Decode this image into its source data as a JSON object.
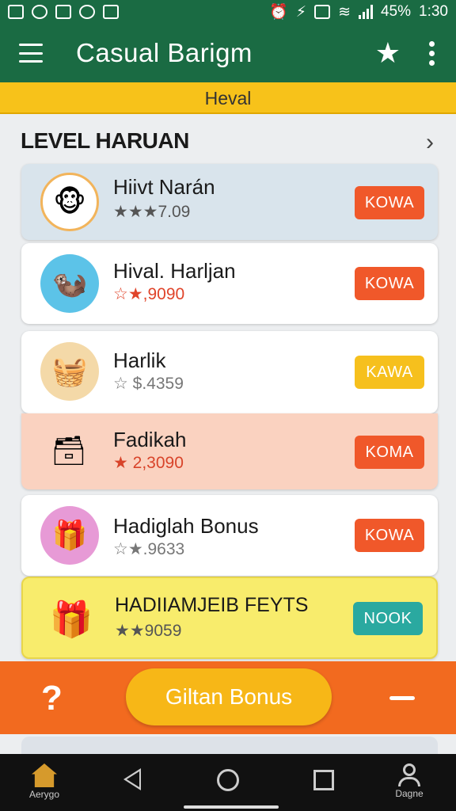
{
  "status_bar": {
    "battery": "45%",
    "time": "1:30"
  },
  "app_bar": {
    "title": "Casual  Barigm"
  },
  "banner": {
    "text": "Heval"
  },
  "section": {
    "title": "LEVEL HARUAN"
  },
  "items": [
    {
      "name": "Hiivt Narán",
      "rating": "★★★7.09",
      "button": "KOWA",
      "button_color": "#f0582a",
      "card_bg": "#d9e4ec",
      "avatar_bg": "#ffffff"
    },
    {
      "name": "Hival. Harljan",
      "rating": "☆★,9090",
      "button": "KOWA",
      "button_color": "#f0582a",
      "card_bg": "#ffffff",
      "avatar_bg": "#5cc3e8"
    },
    {
      "name": "Harlik",
      "rating": "☆ $.4359",
      "button": "KAWA",
      "button_color": "#f6c01d",
      "card_bg": "#ffffff",
      "avatar_bg": "#f4d9a8"
    },
    {
      "name": "Fadikah",
      "rating": "★ 2,3090",
      "button": "KOMA",
      "button_color": "#f0582a",
      "card_bg": "#fad2c0",
      "avatar_bg": "transparent"
    },
    {
      "name": "Hadiglah Bonus",
      "rating": "☆★.9633",
      "button": "KOWA",
      "button_color": "#f0582a",
      "card_bg": "#ffffff",
      "avatar_bg": "#e79ad6"
    },
    {
      "name": "HADIIAMJEIB FEYTS",
      "rating": "★★9059",
      "button": "NOOK",
      "button_color": "#2aa9a0",
      "card_bg": "#f8ec6c",
      "avatar_bg": "transparent"
    }
  ],
  "action_bar": {
    "bonus_button": "Giltan Bonus"
  },
  "nav_bar": {
    "home_label": "Aerygo",
    "profile_label": "Dagne"
  }
}
